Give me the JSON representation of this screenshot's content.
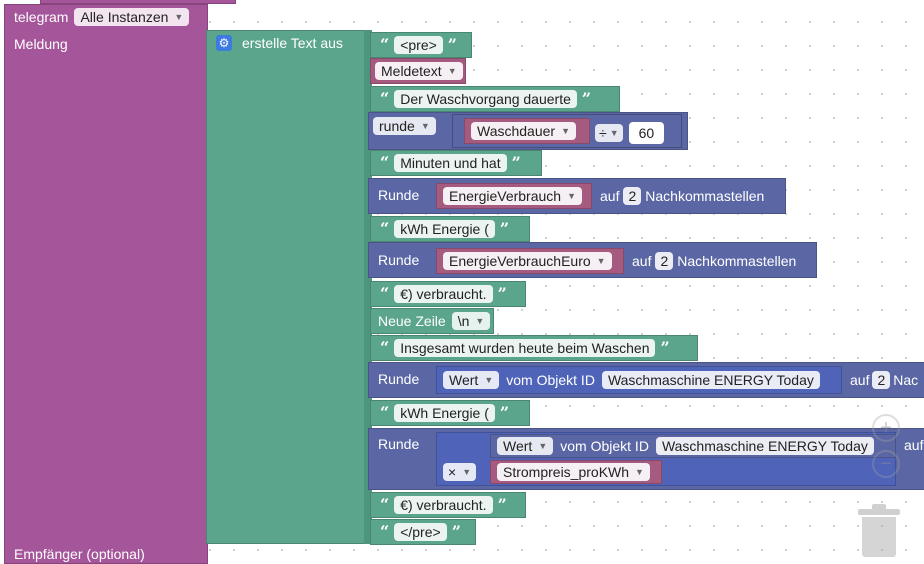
{
  "telegram": {
    "label": "telegram",
    "instance": "Alle Instanzen",
    "message_label": "Meldung",
    "recipient_label": "Empfänger (optional)"
  },
  "join": {
    "label": "erstelle Text aus",
    "gear_icon": "gear-icon"
  },
  "items": {
    "pre_open": "<pre>",
    "meldetext": "Meldetext",
    "waschvorgang": "Der Waschvorgang dauerte",
    "runde_label": "runde",
    "waschdauer": "Waschdauer",
    "divide_op": "÷",
    "sixty": "60",
    "minuten": "Minuten und hat",
    "runde2": "Runde",
    "energie": "EnergieVerbrauch",
    "auf": "auf",
    "two": "2",
    "nachkomma": "Nachkommastellen",
    "kwh1": "kWh Energie (",
    "runde3": "Runde",
    "energie_euro": "EnergieVerbrauchEuro",
    "auf2": "auf",
    "two2": "2",
    "nachkomma2": "Nachkommastellen",
    "verbraucht1": "€) verbraucht.",
    "neue_zeile": "Neue Zeile",
    "newline": "\\n",
    "insgesamt": "Insgesamt wurden heute beim Waschen",
    "runde4": "Runde",
    "wert1": "Wert",
    "vom_objekt1": "vom Objekt ID",
    "objekt1": "Waschmaschine ENERGY  Today",
    "auf3": "auf",
    "two3": "2",
    "nac": "Nac",
    "kwh2": "kWh Energie (",
    "runde5": "Runde",
    "wert2": "Wert",
    "vom_objekt2": "vom Objekt ID",
    "objekt2": "Waschmaschine ENERGY  Today",
    "auf4": "auf",
    "multiply_op": "×",
    "strompreis": "Strompreis_proKWh",
    "verbraucht2": "€) verbraucht.",
    "pre_close": "</pre>"
  },
  "colors": {
    "telegram": "#a5559a",
    "text": "#5ba58c",
    "math": "#5b67a5",
    "variable": "#a55b80"
  }
}
